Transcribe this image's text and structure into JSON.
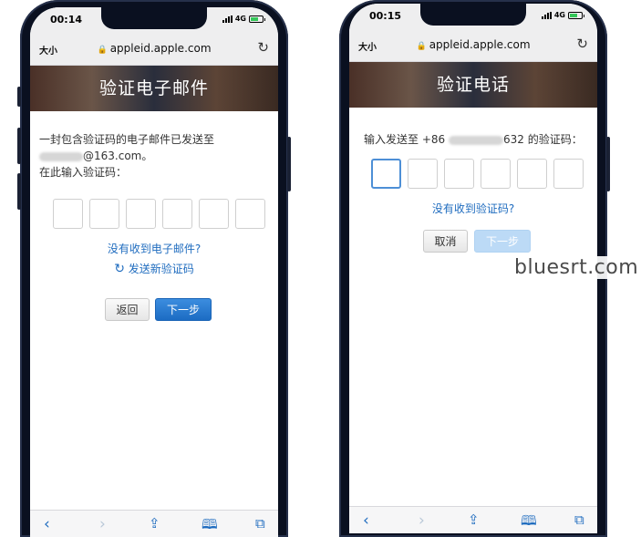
{
  "left_screen": {
    "status": {
      "time": "00:14",
      "network": "4G"
    },
    "browser": {
      "text_size": "大小",
      "url": "appleid.apple.com"
    },
    "banner_title": "验证电子邮件",
    "message_line1": "一封包含验证码的电子邮件已发送至",
    "email_suffix": "@163.com。",
    "message_line2": "在此输入验证码：",
    "code_length": 6,
    "link_no_email": "没有收到电子邮件?",
    "link_resend": "发送新验证码",
    "back_label": "返回",
    "next_label": "下一步"
  },
  "right_screen": {
    "status": {
      "time": "00:15",
      "network": "4G"
    },
    "browser": {
      "text_size": "大小",
      "url": "appleid.apple.com"
    },
    "banner_title": "验证电话",
    "prompt_prefix": "输入发送至 +86",
    "prompt_suffix": "632 的验证码：",
    "code_length": 6,
    "link_no_code": "没有收到验证码?",
    "cancel_label": "取消",
    "next_label": "下一步"
  },
  "icons": {
    "back": "chevron-left-icon",
    "forward": "chevron-right-icon",
    "share": "share-icon",
    "bookmarks": "book-icon",
    "tabs": "tabs-icon",
    "lock": "lock-icon",
    "reload": "reload-icon"
  },
  "colors": {
    "link": "#1f6cbf",
    "primary_button": "#2478d0",
    "focus_border": "#4d8fd6"
  },
  "watermark": "bluesrt.com"
}
